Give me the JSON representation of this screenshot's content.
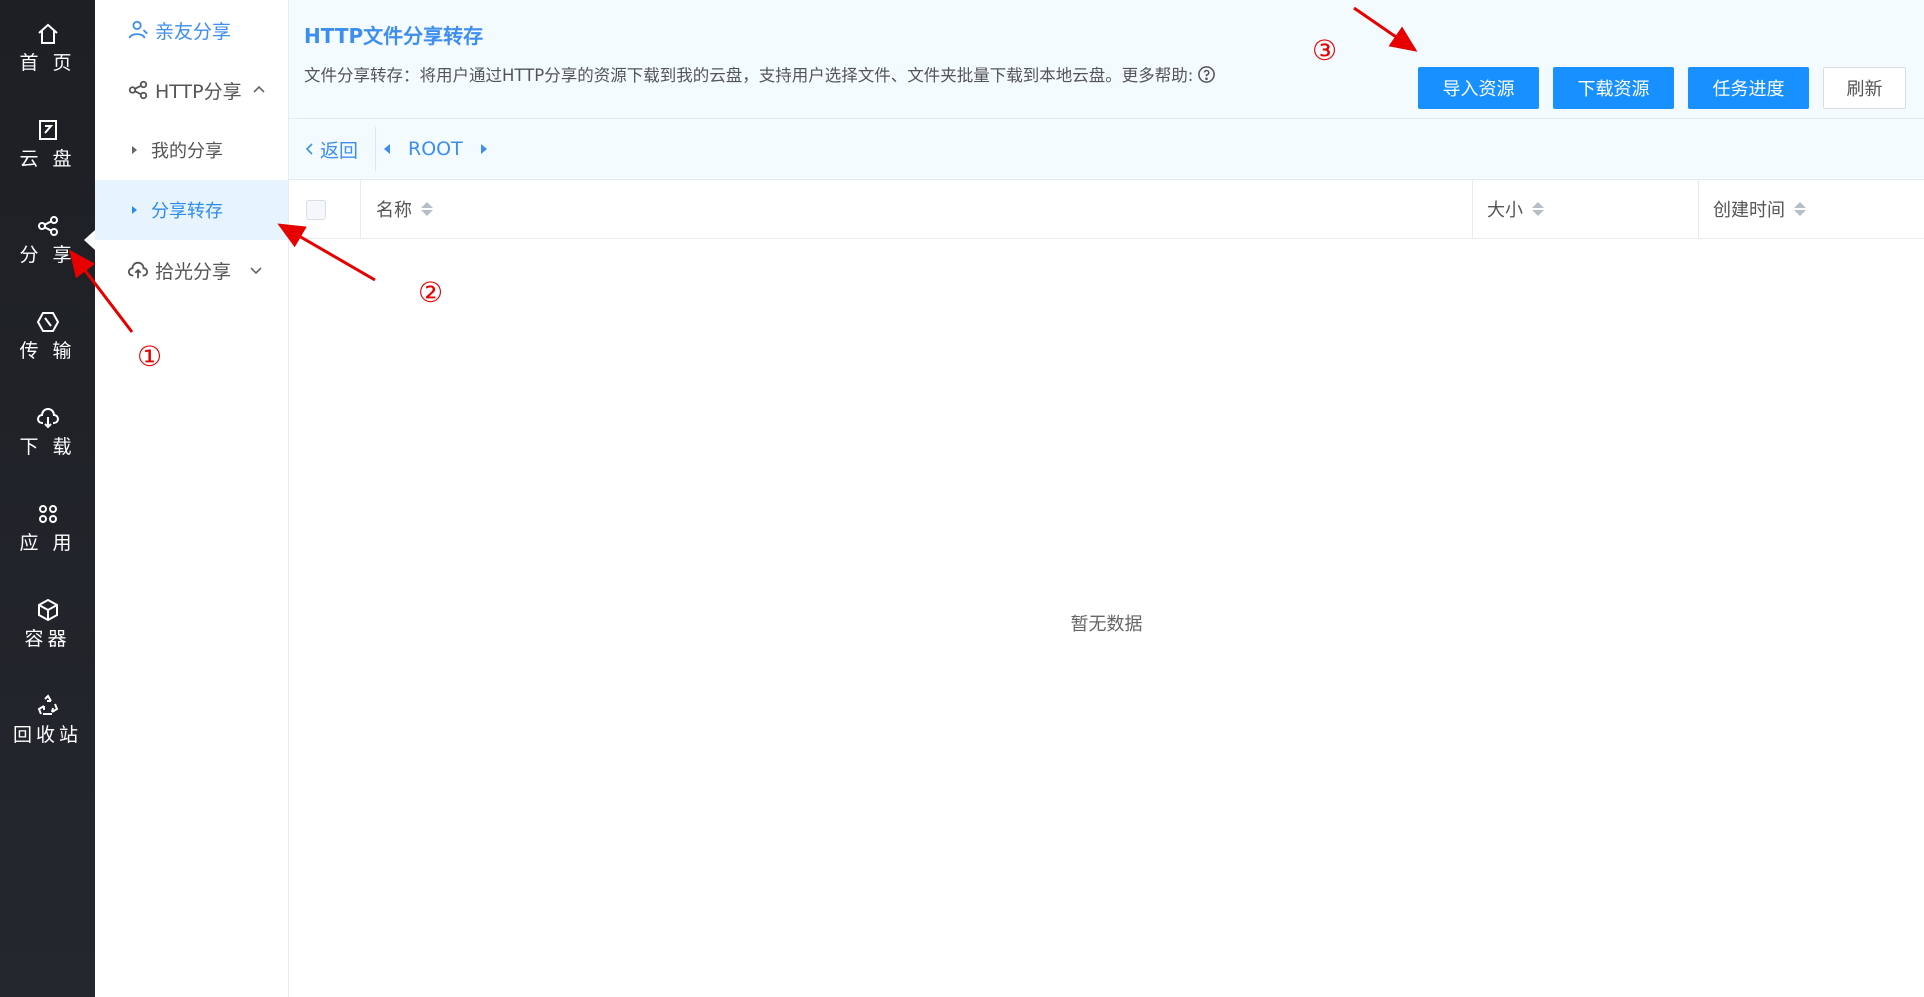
{
  "rail": {
    "items": [
      {
        "label": "首 页",
        "icon": "home-icon"
      },
      {
        "label": "云 盘",
        "icon": "cloud-disk-icon"
      },
      {
        "label": "分 享",
        "icon": "share-icon"
      },
      {
        "label": "传 输",
        "icon": "transfer-icon"
      },
      {
        "label": "下 载",
        "icon": "download-icon"
      },
      {
        "label": "应 用",
        "icon": "apps-icon"
      },
      {
        "label": "容器",
        "icon": "container-icon"
      },
      {
        "label": "回收站",
        "icon": "recycle-icon"
      }
    ],
    "active": "分 享"
  },
  "subnav": {
    "friends_share": "亲友分享",
    "http_share": "HTTP分享",
    "my_share": "我的分享",
    "share_transfer": "分享转存",
    "pick_light_share": "拾光分享"
  },
  "header": {
    "title": "HTTP文件分享转存",
    "description": "文件分享转存：将用户通过HTTP分享的资源下载到我的云盘，支持用户选择文件、文件夹批量下载到本地云盘。更多帮助:",
    "buttons": {
      "import": "导入资源",
      "download": "下载资源",
      "progress": "任务进度",
      "refresh": "刷新"
    }
  },
  "toolbar": {
    "back": "返回",
    "breadcrumb": "ROOT"
  },
  "table": {
    "columns": [
      "名称",
      "大小",
      "创建时间"
    ],
    "empty_text": "暂无数据"
  },
  "annotations": [
    "①",
    "②",
    "③"
  ],
  "colors": {
    "accent": "#1890ff",
    "rail_bg": "#1d1f24",
    "annotation": "#e60000"
  }
}
